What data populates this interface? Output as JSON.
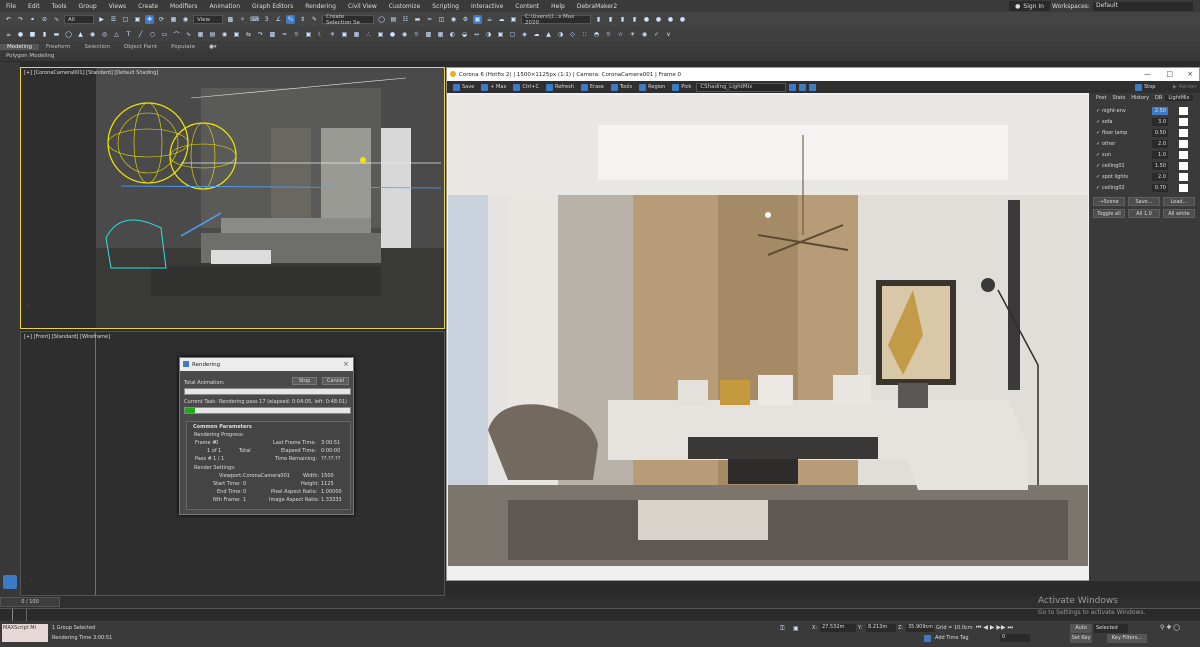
{
  "menu": {
    "items": [
      "File",
      "Edit",
      "Tools",
      "Group",
      "Views",
      "Create",
      "Modifiers",
      "Animation",
      "Graph Editors",
      "Rendering",
      "Civil View",
      "Customize",
      "Scripting",
      "Interactive",
      "Content",
      "Help",
      "DebraMaker2"
    ],
    "signin": "Sign In",
    "workspaces_label": "Workspaces:",
    "workspace_value": "Default"
  },
  "toolbar": {
    "filter": "All",
    "view": "View",
    "selection_set": "Create Selection Se",
    "path": "C:\\Users\\\\l...s Max 2020"
  },
  "ribbon": {
    "tabs": [
      "Modeling",
      "Freeform",
      "Selection",
      "Object Paint",
      "Populate"
    ],
    "sub": "Polygon Modeling"
  },
  "viewports": {
    "perspective_label": "[+] [CoronaCamera001] [Standard] [Default Shading]",
    "front_label": "[+] [Front] [Standard] [Wireframe]"
  },
  "render_dialog": {
    "title": "Rendering",
    "total_animation": "Total Animation:",
    "stop": "Stop",
    "cancel": "Cancel",
    "current_task_label": "Current Task:",
    "current_task": "Rendering pass 17 (elapsed: 0:04:05, left: 0:48:01)",
    "progress": 0.06,
    "common_params": "Common Parameters",
    "rendering_progress": "Rendering Progress:",
    "frame_label": "Frame #",
    "frame_val": "0",
    "last_frame_time": "Last Frame Time:",
    "last_frame_time_val": "3:00:51",
    "one_of_one": "1 of 1",
    "total": "Total",
    "elapsed_time": "Elapsed Time:",
    "elapsed_time_val": "0:00:00",
    "pass_label": "Pass #",
    "pass_val": "1 / 1",
    "time_remaining": "Time Remaining:",
    "time_remaining_val": "??:??:??",
    "render_settings": "Render Settings:",
    "viewport_label": "Viewport:",
    "viewport_val": "CoronaCamera001",
    "width_label": "Width:",
    "width_val": "1500",
    "start_time_label": "Start Time:",
    "start_time_val": "0",
    "height_label": "Height:",
    "height_val": "1125",
    "end_time_label": "End Time:",
    "end_time_val": "0",
    "pixel_aspect_label": "Pixel Aspect Ratio:",
    "pixel_aspect_val": "1.00000",
    "nth_frame_label": "Nth Frame:",
    "nth_frame_val": "1",
    "image_aspect_label": "Image Aspect Ratio:",
    "image_aspect_val": "1.33333"
  },
  "vfb": {
    "title": "Corona 6 (Hotfix 2) | 1500×1125px (1:1) | Camera: CoronaCamera001 | Frame 0",
    "buttons": [
      "Save",
      "+ Max",
      "Ctrl+C",
      "Refresh",
      "Erase",
      "Tools",
      "Region",
      "Pick"
    ],
    "shading_dd": "CShading_LightMix",
    "stop": "Stop",
    "render": "Render",
    "side_tabs": [
      "Post",
      "Stats",
      "History",
      "DR",
      "LightMix"
    ],
    "lights": [
      {
        "name": "night-env",
        "value": "2.50",
        "checked": true
      },
      {
        "name": "sofa",
        "value": "3.0",
        "checked": true
      },
      {
        "name": "floor lamp",
        "value": "0.50",
        "checked": true
      },
      {
        "name": "other",
        "value": "2.0",
        "checked": true
      },
      {
        "name": "sun",
        "value": "1.0",
        "checked": true
      },
      {
        "name": "ceiling01",
        "value": "1.50",
        "checked": true
      },
      {
        "name": "spot lights",
        "value": "2.0",
        "checked": true
      },
      {
        "name": "ceiling02",
        "value": "0.70",
        "checked": true
      }
    ],
    "btn_scene": "→Scene",
    "btn_save": "Save...",
    "btn_load": "Load...",
    "btn_toggle": "Toggle all",
    "btn_all10": "All 1.0",
    "btn_allwhite": "All white"
  },
  "timeline": {
    "frame": "0 / 100",
    "status1": "1 Group Selected",
    "status2": "Rendering Time  3:00:51",
    "maxscript": "MAXScript Mi",
    "x_label": "X:",
    "x_val": "27.532m",
    "y_label": "Y:",
    "y_val": "8.213m",
    "z_label": "Z:",
    "z_val": "35.909cm",
    "grid": "Grid = 10.0cm",
    "add_time_tag": "Add Time Tag",
    "auto_key": "Auto Key",
    "selected": "Selected",
    "set_key": "Set Key",
    "key_filters": "Key Filters...",
    "frame_field": "0"
  },
  "watermark": {
    "title": "Activate Windows",
    "sub": "Go to Settings to activate Windows."
  },
  "colors": {
    "accent_blue": "#3d7bc4",
    "viewport_active_border": "#e8d24a",
    "progress_green": "#1ea81e"
  }
}
